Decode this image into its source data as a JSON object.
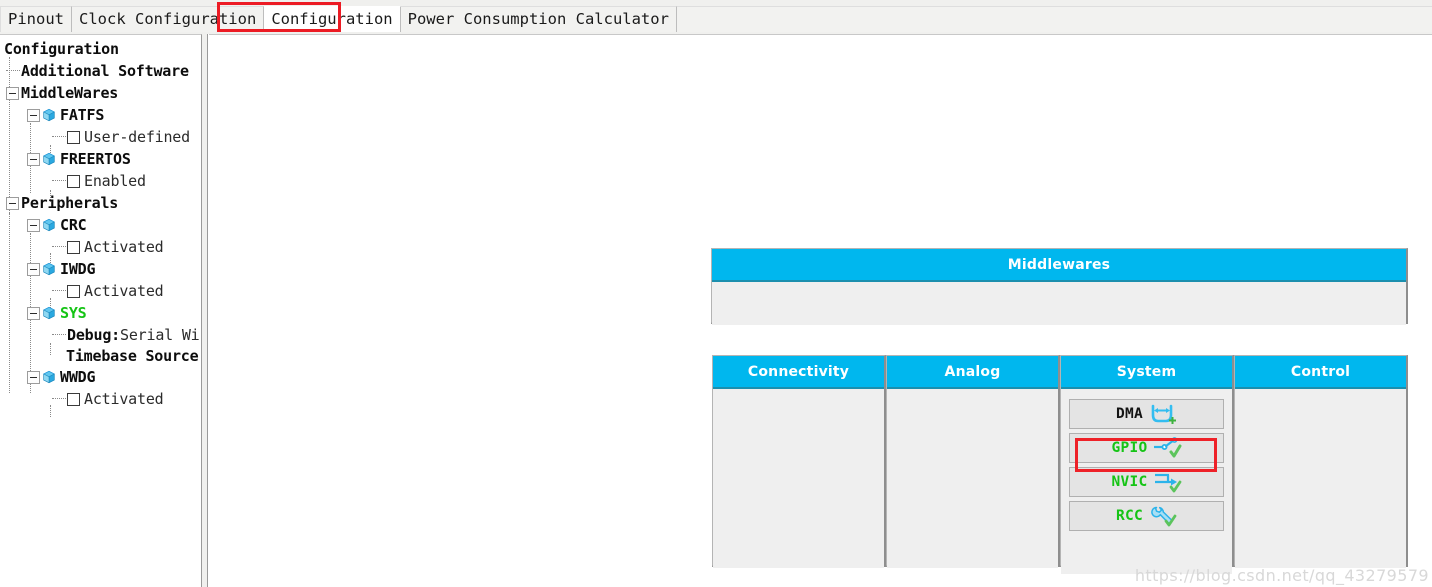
{
  "tabs": [
    {
      "label": "Pinout",
      "selected": false
    },
    {
      "label": "Clock Configuration",
      "selected": false
    },
    {
      "label": "Configuration",
      "selected": true
    },
    {
      "label": "Power Consumption Calculator",
      "selected": false
    }
  ],
  "tree": {
    "root_label": "Configuration",
    "nodes": [
      {
        "label": "Configuration",
        "kind": "root",
        "style": "bold",
        "indent": 0
      },
      {
        "label": "Additional Software",
        "kind": "leaf",
        "style": "bold",
        "indent": 1
      },
      {
        "label": "MiddleWares",
        "kind": "group",
        "style": "bold",
        "indent": 0
      },
      {
        "label": "FATFS",
        "kind": "ip",
        "style": "bold",
        "indent": 1
      },
      {
        "label": "User-defined",
        "kind": "checkbox",
        "style": "plain",
        "indent": 2,
        "checked": false
      },
      {
        "label": "FREERTOS",
        "kind": "ip",
        "style": "bold",
        "indent": 1
      },
      {
        "label": "Enabled",
        "kind": "checkbox",
        "style": "plain",
        "indent": 2,
        "checked": false
      },
      {
        "label": "Peripherals",
        "kind": "group",
        "style": "bold",
        "indent": 0
      },
      {
        "label": "CRC",
        "kind": "ip",
        "style": "bold",
        "indent": 1
      },
      {
        "label": "Activated",
        "kind": "checkbox",
        "style": "plain",
        "indent": 2,
        "checked": false
      },
      {
        "label": "IWDG",
        "kind": "ip",
        "style": "bold",
        "indent": 1
      },
      {
        "label": "Activated",
        "kind": "checkbox",
        "style": "plain",
        "indent": 2,
        "checked": false
      },
      {
        "label": "SYS",
        "kind": "ip",
        "style": "green",
        "indent": 1
      },
      {
        "label": "Debug:Serial Wire",
        "kind": "text",
        "style": "mixed",
        "indent": 2
      },
      {
        "label": "Timebase Source",
        "kind": "text2",
        "style": "bold",
        "indent": 2
      },
      {
        "label": "WWDG",
        "kind": "ip",
        "style": "bold",
        "indent": 1
      },
      {
        "label": "Activated",
        "kind": "checkbox",
        "style": "plain",
        "indent": 2,
        "checked": false
      }
    ],
    "sys_debug_key": "Debug:",
    "sys_debug_value": "Serial Wire",
    "sys_timebase": "Timebase Source"
  },
  "canvas": {
    "middlewares": {
      "title": "Middlewares",
      "items": []
    },
    "categories": [
      {
        "title": "Connectivity",
        "items": []
      },
      {
        "title": "Analog",
        "items": []
      },
      {
        "title": "System",
        "items": [
          {
            "label": "DMA",
            "label_color": "black",
            "icon": "dma-icon",
            "badge": "plus"
          },
          {
            "label": "GPIO",
            "label_color": "green",
            "icon": "gpio-icon",
            "badge": "check"
          },
          {
            "label": "NVIC",
            "label_color": "green",
            "icon": "nvic-icon",
            "badge": "check"
          },
          {
            "label": "RCC",
            "label_color": "green",
            "icon": "rcc-icon",
            "badge": "check"
          }
        ]
      },
      {
        "title": "Control",
        "items": []
      }
    ]
  },
  "annotations": {
    "tab_highlight": "Configuration",
    "button_highlight": "GPIO",
    "color": "#ee2128"
  },
  "watermark": "https://blog.csdn.net/qq_43279579",
  "colors": {
    "header_blue": "#00b7ee",
    "header_blue_shadow": "#1b8fae",
    "panel_gray": "#efefef",
    "button_gray": "#e4e4e4",
    "configured_green": "#15c415",
    "annotation_red": "#ee2128"
  }
}
